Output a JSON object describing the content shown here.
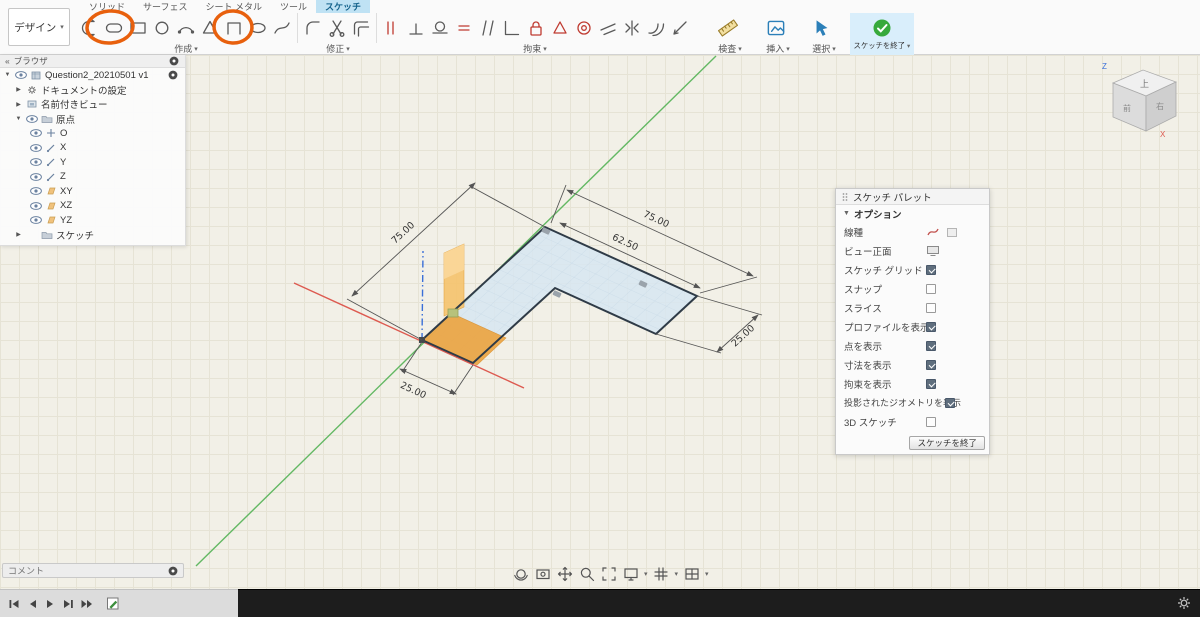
{
  "app": {
    "design_label": "デザイン"
  },
  "tabs": [
    {
      "label": "ソリッド"
    },
    {
      "label": "サーフェス"
    },
    {
      "label": "シート メタル"
    },
    {
      "label": "ツール"
    },
    {
      "label": "スケッチ"
    }
  ],
  "toolbar": {
    "group_create": "作成",
    "group_modify": "修正",
    "group_constraints": "拘束",
    "group_inspect": "検査",
    "group_insert": "挿入",
    "group_select": "選択",
    "finish_sketch": "スケッチを終了"
  },
  "browser": {
    "panel_title": "ブラウザ",
    "root_label": "Question2_20210501 v1",
    "doc_settings": "ドキュメントの設定",
    "named_views": "名前付きビュー",
    "origin": "原点",
    "origin_children": [
      {
        "label": "O"
      },
      {
        "label": "X"
      },
      {
        "label": "Y"
      },
      {
        "label": "Z"
      },
      {
        "label": "XY"
      },
      {
        "label": "XZ"
      },
      {
        "label": "YZ"
      }
    ],
    "sketches": "スケッチ"
  },
  "palette": {
    "title": "スケッチ パレット",
    "options_section": "オプション",
    "rows": [
      {
        "label": "線種",
        "checked": false
      },
      {
        "label": "ビュー正面",
        "checked": false
      },
      {
        "label": "スケッチ グリッド",
        "checked": true
      },
      {
        "label": "スナップ",
        "checked": false
      },
      {
        "label": "スライス",
        "checked": false
      },
      {
        "label": "プロファイルを表示",
        "checked": true
      },
      {
        "label": "点を表示",
        "checked": true
      },
      {
        "label": "寸法を表示",
        "checked": true
      },
      {
        "label": "拘束を表示",
        "checked": true
      },
      {
        "label": "投影されたジオメトリを表示",
        "checked": true
      },
      {
        "label": "3D スケッチ",
        "checked": false
      }
    ],
    "finish_button": "スケッチを終了"
  },
  "canvas": {
    "dim_left": "75.00",
    "dim_top": "75.00",
    "dim_mid": "62.50",
    "dim_right": "25.00",
    "dim_bottom": "25.00"
  },
  "viewcube": {
    "top": "上",
    "front": "前",
    "right": "右",
    "axis_x": "X",
    "axis_z": "Z"
  },
  "comment_box": {
    "placeholder": "コメント"
  },
  "colors": {
    "accent_blue": "#bfe2f4",
    "finish_green": "#37a93c",
    "annotation_orange": "#e8600d"
  }
}
